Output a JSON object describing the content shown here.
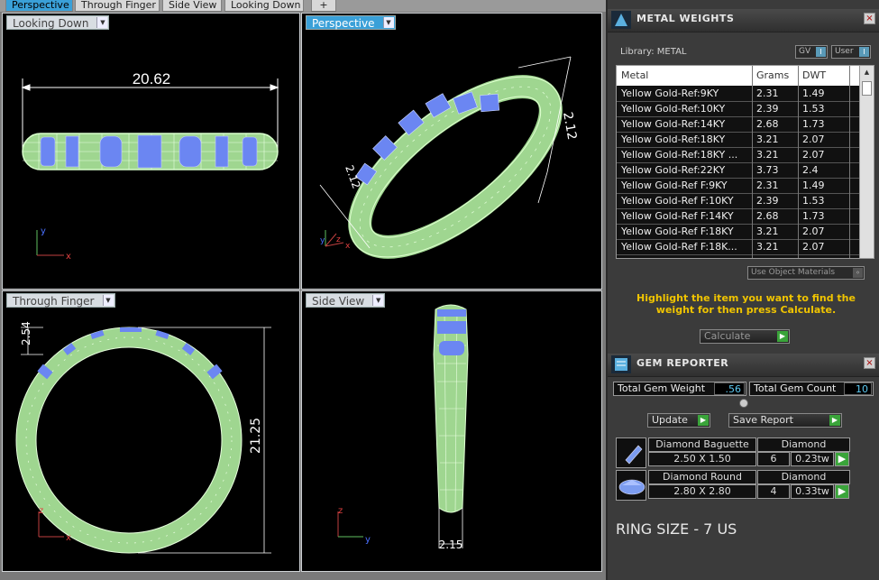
{
  "tabs": [
    {
      "label": "Perspective",
      "active": true
    },
    {
      "label": "Through Finger",
      "active": false
    },
    {
      "label": "Side View",
      "active": false
    },
    {
      "label": "Looking Down",
      "active": false
    },
    {
      "label": "+",
      "active": false
    }
  ],
  "viewports": {
    "looking_down": {
      "label": "Looking Down",
      "dimension": "20.62"
    },
    "perspective": {
      "label": "Perspective",
      "dimension_a": "2.12",
      "dimension_b": "2.12"
    },
    "through_finger": {
      "label": "Through Finger",
      "dimension_a": "2.54",
      "dimension_b": "21.25"
    },
    "side_view": {
      "label": "Side View",
      "dimension": "2.15"
    }
  },
  "axes": {
    "x": "x",
    "y": "y",
    "z": "z"
  },
  "metal_weights": {
    "title": "METAL WEIGHTS",
    "library_label": "Library: METAL",
    "gv_label": "GV",
    "user_label": "User",
    "columns": [
      "Metal",
      "Grams",
      "DWT"
    ],
    "rows": [
      [
        "Yellow Gold-Ref:9KY",
        "2.31",
        "1.49"
      ],
      [
        "Yellow Gold-Ref:10KY",
        "2.39",
        "1.53"
      ],
      [
        "Yellow Gold-Ref:14KY",
        "2.68",
        "1.73"
      ],
      [
        "Yellow Gold-Ref:18KY",
        "3.21",
        "2.07"
      ],
      [
        "Yellow Gold-Ref:18KY ...",
        "3.21",
        "2.07"
      ],
      [
        "Yellow Gold-Ref:22KY",
        "3.73",
        "2.4"
      ],
      [
        "Yellow Gold-Ref F:9KY",
        "2.31",
        "1.49"
      ],
      [
        "Yellow Gold-Ref F:10KY",
        "2.39",
        "1.53"
      ],
      [
        "Yellow Gold-Ref F:14KY",
        "2.68",
        "1.73"
      ],
      [
        "Yellow Gold-Ref F:18KY",
        "3.21",
        "2.07"
      ],
      [
        "Yellow Gold-Ref F:18K...",
        "3.21",
        "2.07"
      ]
    ],
    "use_object_materials": "Use Object Materials",
    "hint": "Highlight the item you want to find the weight for then press Calculate.",
    "calculate_label": "Calculate"
  },
  "gem_reporter": {
    "title": "GEM REPORTER",
    "total_weight_label": "Total Gem Weight",
    "total_weight_value": ".56",
    "total_count_label": "Total Gem Count",
    "total_count_value": "10",
    "update_label": "Update",
    "save_report_label": "Save Report",
    "gems": [
      {
        "shape": "Diamond Baguette",
        "material": "Diamond",
        "size": "2.50 X 1.50",
        "count": "6",
        "weight": "0.23tw"
      },
      {
        "shape": "Diamond Round",
        "material": "Diamond",
        "size": "2.80 X 2.80",
        "count": "4",
        "weight": "0.33tw"
      }
    ],
    "ring_size": "RING SIZE - 7 US"
  },
  "colors": {
    "ring_wire": "#bff0b0",
    "ring_fill": "#7aa86e",
    "gem_color": "#5c7cf0",
    "highlight_text": "#f0c400",
    "active_tab": "#3aa0d8"
  }
}
